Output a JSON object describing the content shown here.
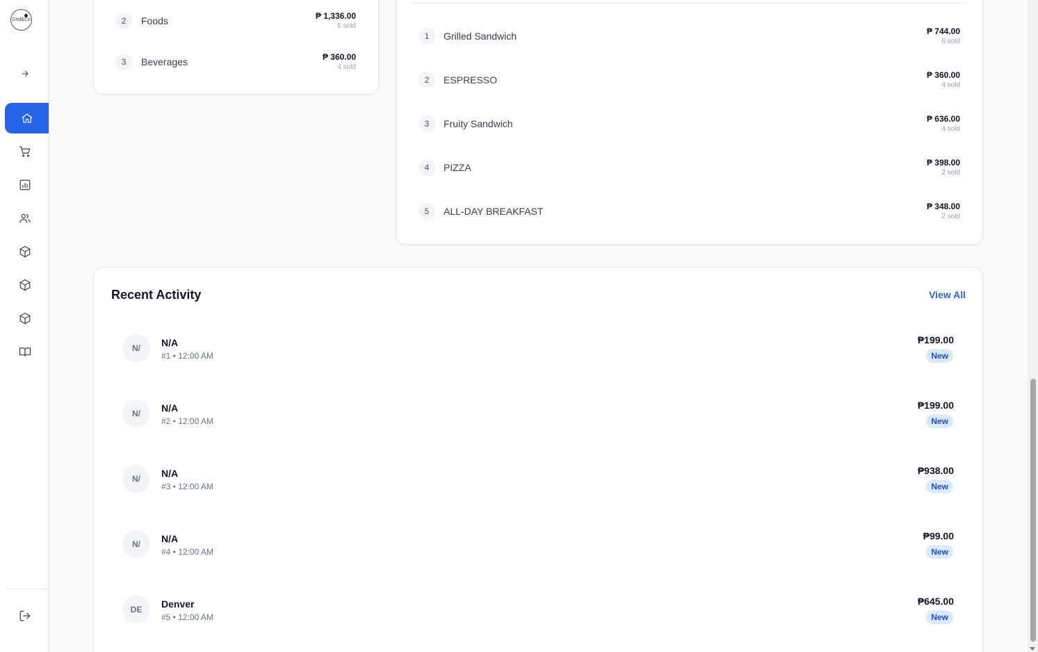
{
  "sidebar": {
    "logo_text": "Grid&Co",
    "icons": [
      "arrow-right-icon",
      "home-icon",
      "cart-icon",
      "bar-chart-icon",
      "users-icon",
      "box-icon",
      "box-icon",
      "box-icon",
      "book-icon",
      "logout-icon"
    ]
  },
  "categories": [
    {
      "rank": "2",
      "name": "Foods",
      "amount": "₱ 1,336.00",
      "sold": "6 sold"
    },
    {
      "rank": "3",
      "name": "Beverages",
      "amount": "₱ 360.00",
      "sold": "4 sold"
    }
  ],
  "products": [
    {
      "rank": "1",
      "name": "Grilled Sandwich",
      "amount": "₱ 744.00",
      "sold": "6 sold"
    },
    {
      "rank": "2",
      "name": "ESPRESSO",
      "amount": "₱ 360.00",
      "sold": "4 sold"
    },
    {
      "rank": "3",
      "name": "Fruity Sandwich",
      "amount": "₱ 636.00",
      "sold": "4 sold"
    },
    {
      "rank": "4",
      "name": "PIZZA",
      "amount": "₱ 398.00",
      "sold": "2 sold"
    },
    {
      "rank": "5",
      "name": "ALL-DAY BREAKFAST",
      "amount": "₱ 348.00",
      "sold": "2 sold"
    }
  ],
  "activity": {
    "title": "Recent Activity",
    "view_all": "View All",
    "items": [
      {
        "initials": "N/",
        "name": "N/A",
        "meta": "#1 • 12:00 AM",
        "amount": "₱199.00",
        "status": "New"
      },
      {
        "initials": "N/",
        "name": "N/A",
        "meta": "#2 • 12:00 AM",
        "amount": "₱199.00",
        "status": "New"
      },
      {
        "initials": "N/",
        "name": "N/A",
        "meta": "#3 • 12:00 AM",
        "amount": "₱938.00",
        "status": "New"
      },
      {
        "initials": "N/",
        "name": "N/A",
        "meta": "#4 • 12:00 AM",
        "amount": "₱99.00",
        "status": "New"
      },
      {
        "initials": "DE",
        "name": "Denver",
        "meta": "#5 • 12:00 AM",
        "amount": "₱645.00",
        "status": "New"
      }
    ]
  },
  "colors": {
    "accent": "#2563eb",
    "badge_bg": "#dbeafe",
    "badge_text": "#1d4ed8",
    "page_bg": "#f8fafc"
  }
}
